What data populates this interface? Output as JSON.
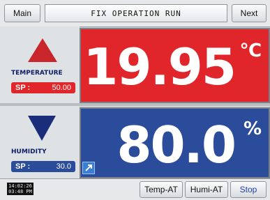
{
  "header": {
    "main_label": "Main",
    "title": "FIX OPERATION RUN",
    "next_label": "Next"
  },
  "temperature": {
    "label": "TEMPERATURE",
    "sp_key": "SP :",
    "sp_value": "50.00",
    "value": "19.95",
    "unit": "℃",
    "trend": "up",
    "panel_color": "#e0262a"
  },
  "humidity": {
    "label": "HUMIDITY",
    "sp_key": "SP :",
    "sp_value": "30.0",
    "value": "80.0",
    "unit": "%",
    "trend": "down",
    "panel_color": "#2b4c9a"
  },
  "footer": {
    "clock_time": "14:02:26",
    "clock_ampm": "03:48 PM",
    "temp_at_label": "Temp-AT",
    "humi_at_label": "Humi-AT",
    "stop_label": "Stop",
    "stop_color": "#1c3fa6"
  },
  "icons": {
    "corner_icon": "resize-arrow-icon"
  }
}
